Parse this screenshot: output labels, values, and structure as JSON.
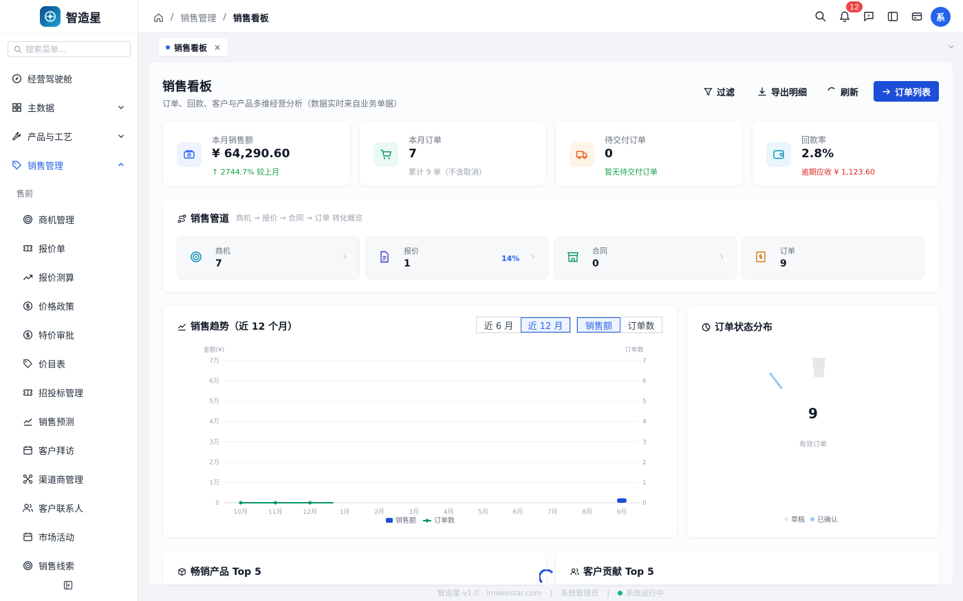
{
  "app": {
    "name": "智造星"
  },
  "sidebar": {
    "search_placeholder": "搜索菜单...",
    "items": [
      {
        "label": "经营驾驶舱"
      },
      {
        "label": "主数据"
      },
      {
        "label": "产品与工艺"
      },
      {
        "label": "销售管理"
      }
    ],
    "group": "售前",
    "sub_items": [
      {
        "label": "商机管理"
      },
      {
        "label": "报价单"
      },
      {
        "label": "报价测算"
      },
      {
        "label": "价格政策"
      },
      {
        "label": "特价审批"
      },
      {
        "label": "价目表"
      },
      {
        "label": "招投标管理"
      },
      {
        "label": "销售预测"
      },
      {
        "label": "客户拜访"
      },
      {
        "label": "渠道商管理"
      },
      {
        "label": "客户联系人"
      },
      {
        "label": "市场活动"
      },
      {
        "label": "销售线索"
      }
    ]
  },
  "topbar": {
    "breadcrumb": [
      "销售管理",
      "销售看板"
    ],
    "notifications": "12",
    "avatar": "系"
  },
  "tabs": [
    {
      "label": "销售看板",
      "close": "×"
    }
  ],
  "page": {
    "title": "销售看板",
    "subtitle": "订单、回款、客户与产品多维经营分析（数据实时来自业务单据）",
    "buttons": {
      "filter": "过滤",
      "export": "导出明细",
      "refresh": "刷新",
      "orders": "订单列表"
    }
  },
  "kpis": [
    {
      "label": "本月销售额",
      "value": "¥ 64,290.60",
      "note": "↑ 2744.7% 较上月",
      "color": "#16a34a"
    },
    {
      "label": "本月订单",
      "value": "7",
      "note": "累计 9 单（不含取消）",
      "color": "#9ca3af"
    },
    {
      "label": "待交付订单",
      "value": "0",
      "note": "暂无待交付订单",
      "color": "#16a34a"
    },
    {
      "label": "回款率",
      "value": "2.8%",
      "note": "逾期应收 ¥ 1,123.60",
      "color": "#dc2626"
    }
  ],
  "pipeline": {
    "title": "销售管道",
    "subtitle": "商机 → 报价 → 合同 → 订单 转化概览",
    "stages": [
      {
        "label": "商机",
        "value": "7",
        "pct": ""
      },
      {
        "label": "报价",
        "value": "1",
        "pct": "14%"
      },
      {
        "label": "合同",
        "value": "0",
        "pct": ""
      },
      {
        "label": "订单",
        "value": "9",
        "pct": ""
      }
    ]
  },
  "trend": {
    "title": "销售趋势（近 12 个月）",
    "range_options": [
      "近 6 月",
      "近 12 月"
    ],
    "metric_options": [
      "销售额",
      "订单数"
    ]
  },
  "chart_data": {
    "type": "bar",
    "title": "",
    "ylabel": "金额(¥)",
    "y2label": "订单数",
    "categories": [
      "10月",
      "11月",
      "12月",
      "1月",
      "2月",
      "3月",
      "4月",
      "5月",
      "6月",
      "7月",
      "8月",
      "9月"
    ],
    "y_ticks": [
      "0",
      "1万",
      "2万",
      "3万",
      "4万",
      "5万",
      "6万",
      "7万"
    ],
    "y2_ticks": [
      "0",
      "1",
      "2",
      "3",
      "4",
      "5",
      "6",
      "7"
    ],
    "ylim": [
      0,
      70000
    ],
    "y2lim": [
      0,
      7
    ],
    "series": [
      {
        "name": "销售额",
        "type": "bar",
        "color": "#1d4ed8",
        "values": [
          0,
          0,
          0,
          0,
          0,
          0,
          0,
          0,
          0,
          0,
          0,
          2200
        ]
      },
      {
        "name": "订单数",
        "type": "line",
        "color": "#059669",
        "values": [
          0,
          0,
          0,
          null,
          null,
          null,
          null,
          null,
          null,
          null,
          null,
          null
        ]
      }
    ]
  },
  "status_dist": {
    "title": "订单状态分布",
    "total": "9",
    "total_label": "有效订单",
    "legend": [
      "草稿",
      "已确认"
    ]
  },
  "bottom": {
    "products_title": "畅销产品 Top 5",
    "customers_title": "客户贡献 Top 5"
  },
  "footer": {
    "version": "智造星 v1.0 · imakestar.com",
    "user": "系统管理员",
    "status": "系统运行中"
  }
}
